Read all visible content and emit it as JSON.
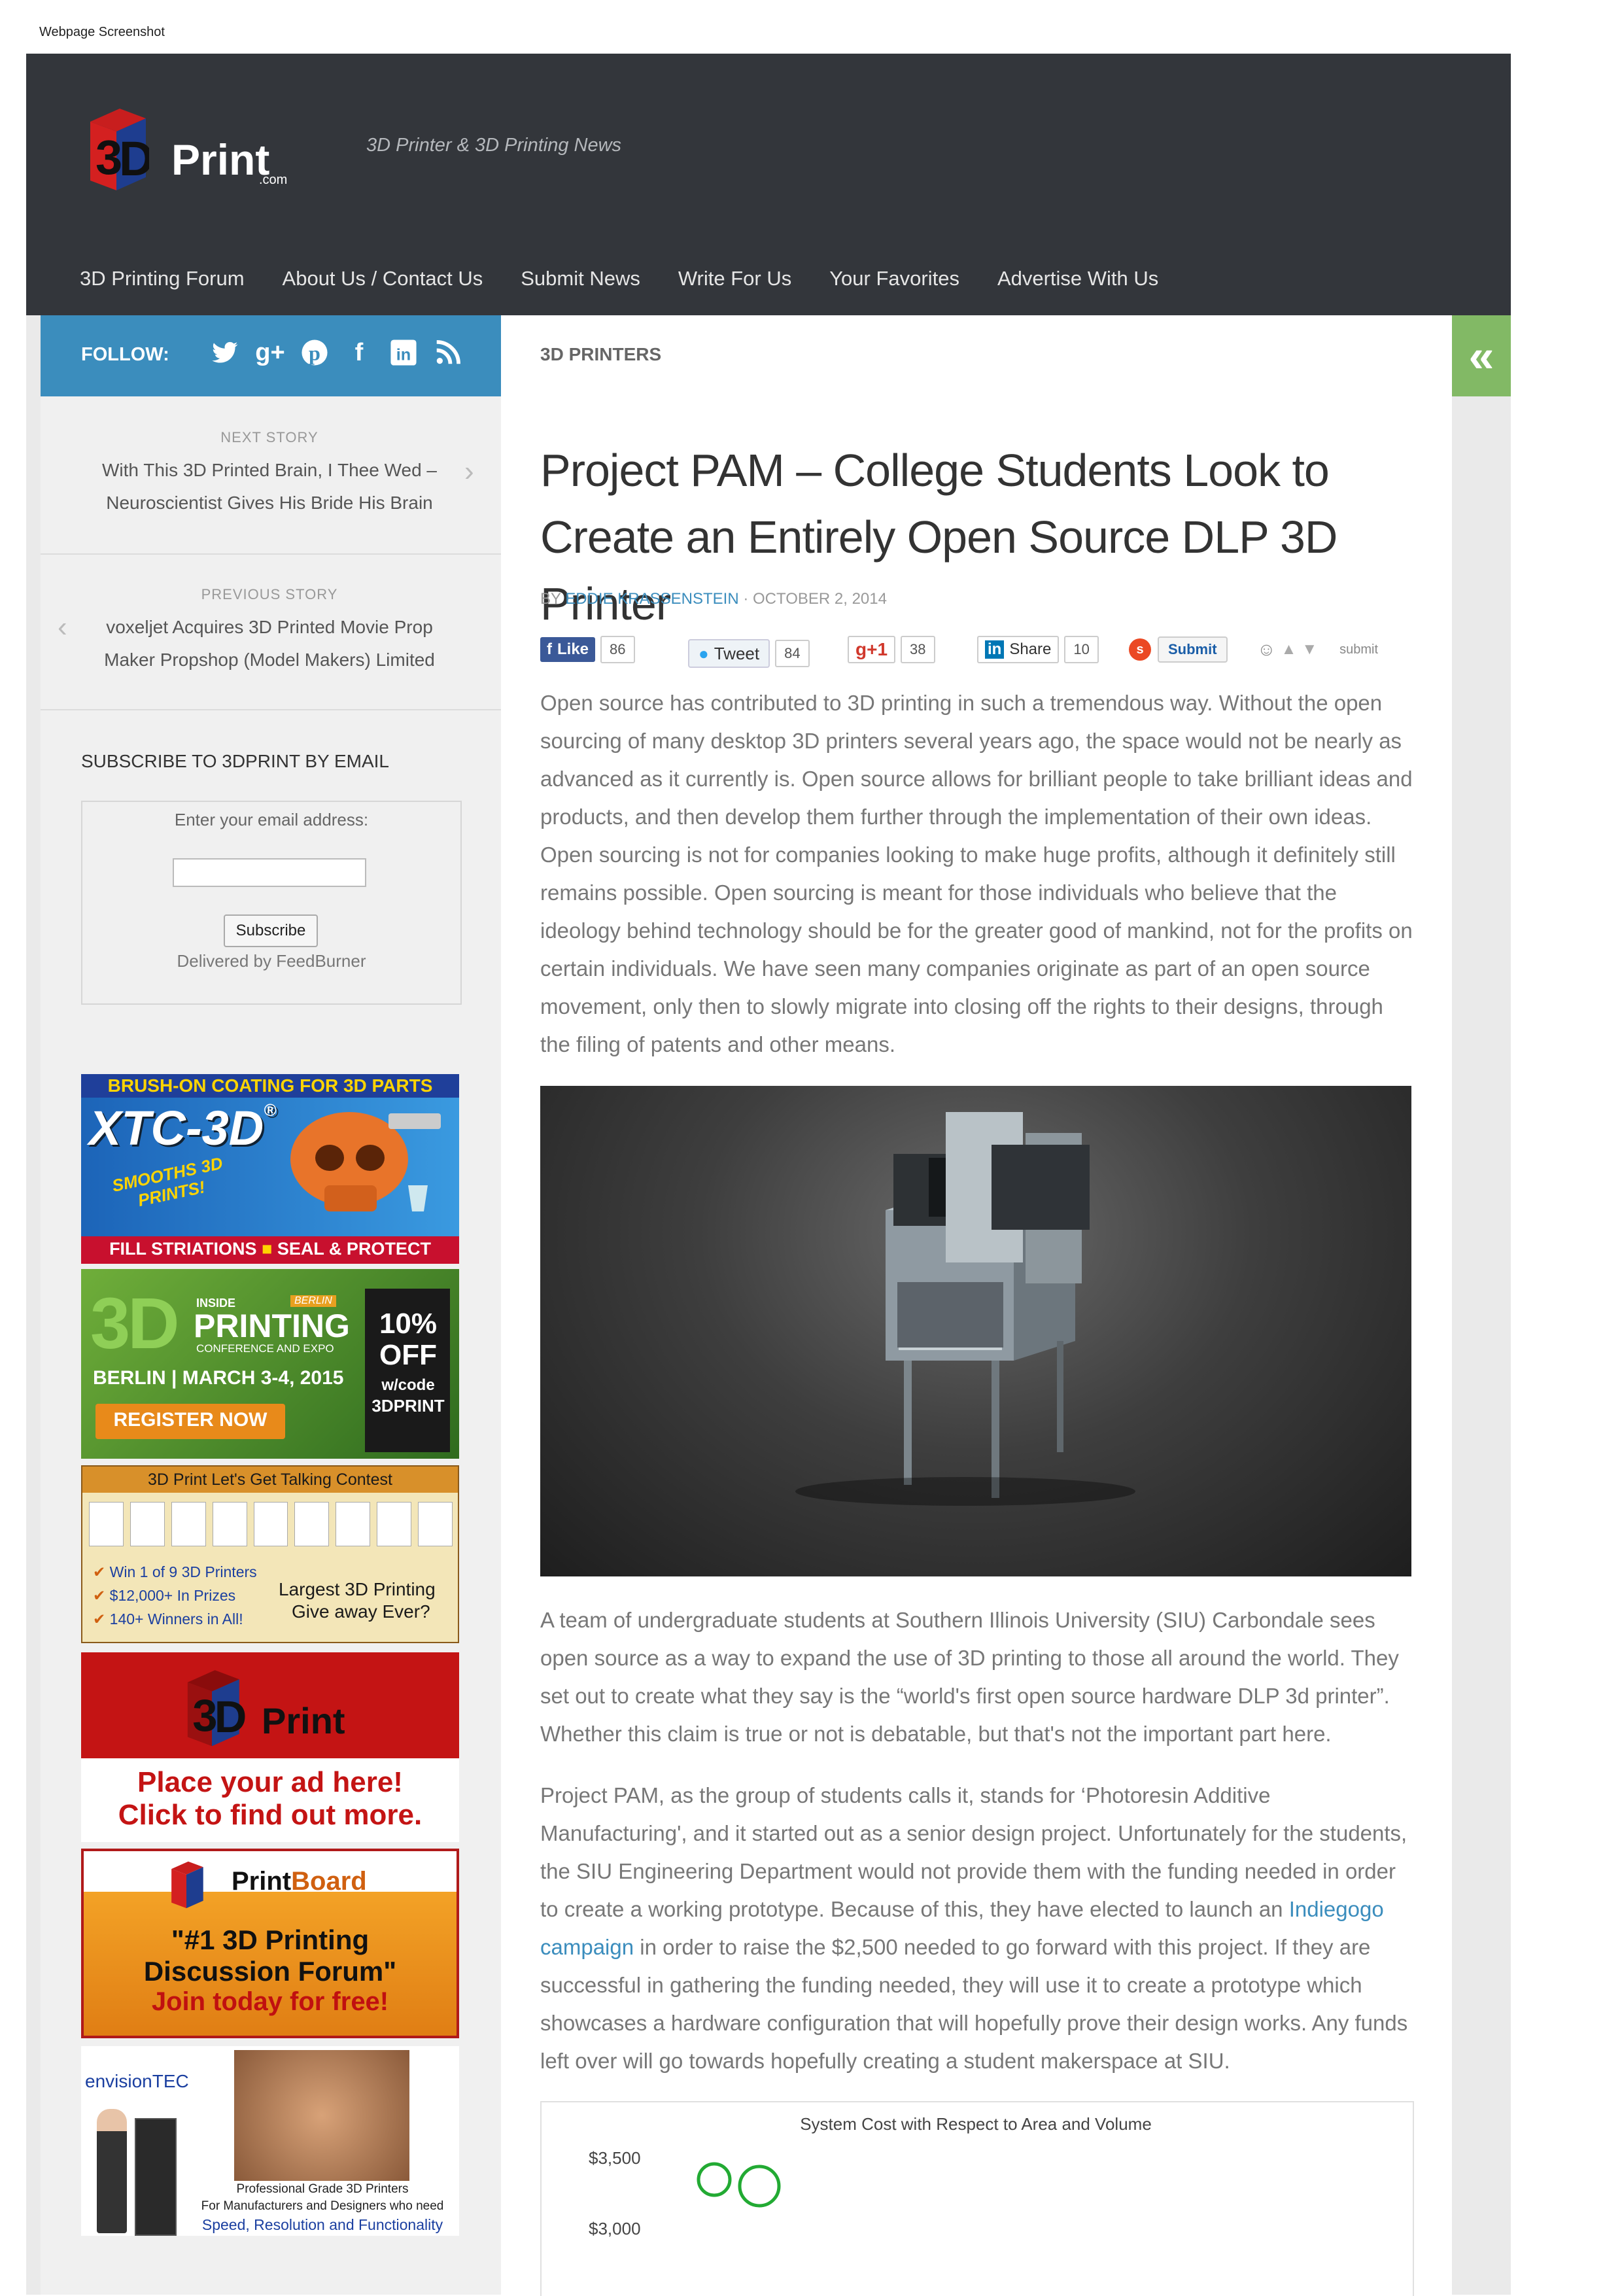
{
  "caption": "Webpage Screenshot",
  "site": {
    "logo_text": "Print",
    "logo_com": ".com",
    "tagline": "3D Printer & 3D Printing News"
  },
  "nav": {
    "items": [
      "3D Printing Forum",
      "About Us / Contact Us",
      "Submit News",
      "Write For Us",
      "Your Favorites",
      "Advertise With Us"
    ]
  },
  "follow": {
    "label": "FOLLOW:",
    "icons": [
      "twitter-icon",
      "google-plus-icon",
      "pinterest-icon",
      "facebook-icon",
      "linkedin-icon",
      "rss-icon"
    ]
  },
  "breadcrumb": "3D PRINTERS",
  "sidebar": {
    "next_label": "NEXT STORY",
    "next_title": "With This 3D Printed Brain, I Thee Wed – Neuroscientist Gives His Bride His Brain",
    "prev_label": "PREVIOUS STORY",
    "prev_title": "voxeljet Acquires 3D Printed Movie Prop Maker Propshop (Model Makers) Limited",
    "subscribe_title": "SUBSCRIBE TO 3DPRINT BY EMAIL",
    "subscribe_prompt": "Enter your email address:",
    "subscribe_button": "Subscribe",
    "delivered_by": "Delivered by FeedBurner"
  },
  "ads": {
    "xtc_top": "BRUSH-ON COATING FOR 3D PARTS",
    "xtc_brand": "XTC-3D",
    "xtc_reg": "®",
    "xtc_smooths": "SMOOTHS 3D PRINTS!",
    "xtc_bottom_1": "FILL STRIATIONS",
    "xtc_bottom_2": "SEAL & PROTECT",
    "berlin_inside": "INSIDE",
    "berlin_tag": "BERLIN",
    "berlin_printing": "PRINTING",
    "berlin_conf": "CONFERENCE AND EXPO",
    "berlin_dates": "BERLIN | MARCH 3-4, 2015",
    "berlin_register": "REGISTER NOW",
    "berlin_off": "10% OFF",
    "berlin_code": "w/code",
    "berlin_code2": "3DPRINT",
    "contest_title": "3D Print Let's Get Talking Contest",
    "contest_line1": "Win 1 of 9 3D Printers",
    "contest_line2": "$12,000+ In Prizes",
    "contest_line3": "140+ Winners in All!",
    "contest_right1": "Largest 3D Printing",
    "contest_right2": "Give away Ever?",
    "place_logo": "Print",
    "place_line1": "Place your ad here!",
    "place_line2": "Click to find out more.",
    "board_logo_print": "Print",
    "board_logo_board": "Board",
    "board_line1": "\"#1 3D Printing",
    "board_line2": "Discussion Forum\"",
    "board_line3": "Join today for free!",
    "env_brand": "envisionTEC",
    "env_line1": "Professional Grade 3D Printers",
    "env_line2": "For Manufacturers and Designers who need",
    "env_line3": "Speed, Resolution and Functionality"
  },
  "article": {
    "title": "Project PAM – College Students Look to Create an Entirely Open Source DLP 3D Printer",
    "by": "BY ",
    "author": "EDDIE KRASSENSTEIN",
    "date": " · OCTOBER 2, 2014",
    "share": {
      "fb_label": "Like",
      "fb_count": "86",
      "tw_label": "Tweet",
      "tw_count": "84",
      "gp_label": "g+1",
      "gp_count": "38",
      "li_label": "Share",
      "li_count": "10",
      "su_label": "Submit",
      "reddit_label": "submit"
    },
    "p1": "Open source has contributed to 3D printing in such a tremendous way. Without the open sourcing of many desktop 3D printers several years ago, the space would not be nearly as advanced as it currently is. Open source allows for brilliant people to take brilliant ideas and products, and then develop them further through the implementation of their own ideas. Open sourcing is not for companies looking to make huge profits, although it definitely still remains possible. Open sourcing is meant for those individuals who believe that the ideology behind technology should be for the greater good of mankind, not for the profits on certain individuals. We have seen many companies originate as part of an open source movement, only then to slowly migrate into closing off the rights to their designs, through the filing of patents and other means.",
    "p2": "A team of undergraduate students at Southern Illinois University (SIU) Carbondale sees open source as a way to expand the use of 3D printing to those all around the world. They set out to create what they say is the “world's first open source hardware DLP 3d printer”. Whether this claim is true or not is debatable, but that's not the important part here.",
    "p3_a": "Project PAM, as the group of students calls it, stands for ‘Photoresin Additive Manufacturing', and it started out as a senior design project. Unfortunately for the students, the SIU Engineering Department would not provide them with the funding needed in order to create a working prototype. Because of this, they have elected to launch an ",
    "p3_link": "Indiegogo campaign",
    "p3_b": " in order to raise the $2,500 needed to go forward with this project. If they are successful in gathering the funding needed, they will use it to create a prototype which showcases a hardware configuration that will hopefully prove their design works. Any funds left over will go towards hopefully creating a student makerspace at SIU."
  },
  "chart_data": {
    "type": "scatter",
    "title": "System Cost with Respect to Area and Volume",
    "ytick_labels": [
      "$3,500",
      "$3,000"
    ],
    "marker_color": "#22aa33"
  }
}
